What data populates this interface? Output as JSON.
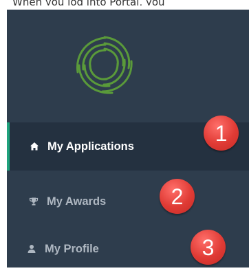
{
  "caption": {
    "text": "When you log into Portal, you"
  },
  "sidebar": {
    "items": [
      {
        "label": "My Applications",
        "icon": "home-icon",
        "active": true
      },
      {
        "label": "My Awards",
        "icon": "trophy-icon",
        "active": false
      },
      {
        "label": "My Profile",
        "icon": "user-icon",
        "active": false
      }
    ]
  },
  "callouts": [
    "1",
    "2",
    "3"
  ],
  "colors": {
    "sidebar_bg": "#2e3d4d",
    "active_bg": "#243140",
    "active_accent": "#1fa37d",
    "logo_green": "#5a9a3a",
    "badge_red": "#e03b35"
  }
}
